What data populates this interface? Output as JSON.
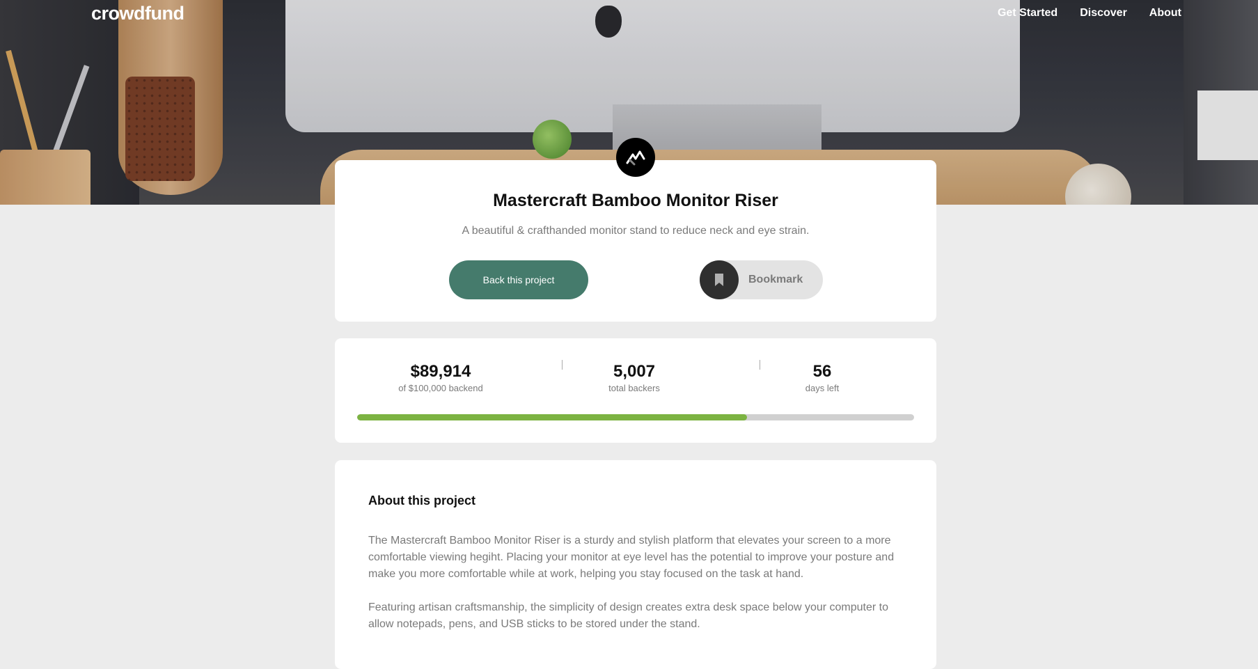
{
  "nav": {
    "logo": "crowdfund",
    "links": [
      "Get Started",
      "Discover",
      "About"
    ]
  },
  "project": {
    "brand_icon": "mastercraft-logo-icon",
    "title": "Mastercraft Bamboo Monitor Riser",
    "description": "A beautiful & crafthanded monitor stand to reduce neck and eye strain.",
    "back_button": "Back this project",
    "bookmark_button": "Bookmark"
  },
  "stats": {
    "backed": "$89,914",
    "backed_label": "of $100,000 backend",
    "backers": "5,007",
    "backers_label": "total backers",
    "days": "56",
    "days_label": "days left",
    "progress_fraction": 0.7
  },
  "about": {
    "title": "About this project",
    "paragraphs": [
      "The Mastercraft Bamboo Monitor Riser is a sturdy and stylish platform that elevates your screen to a more comfortable viewing hegiht. Placing your monitor at eye level has the potential to improve your posture and make you more comfortable while at work, helping you stay focused on the task at hand.",
      "Featuring artisan craftsmanship, the simplicity of design creates extra desk space below your computer to allow notepads, pens, and USB sticks to be stored under the stand."
    ]
  },
  "colors": {
    "accent": "#457b6c",
    "progress": "#7cb342",
    "background": "#ececec"
  }
}
